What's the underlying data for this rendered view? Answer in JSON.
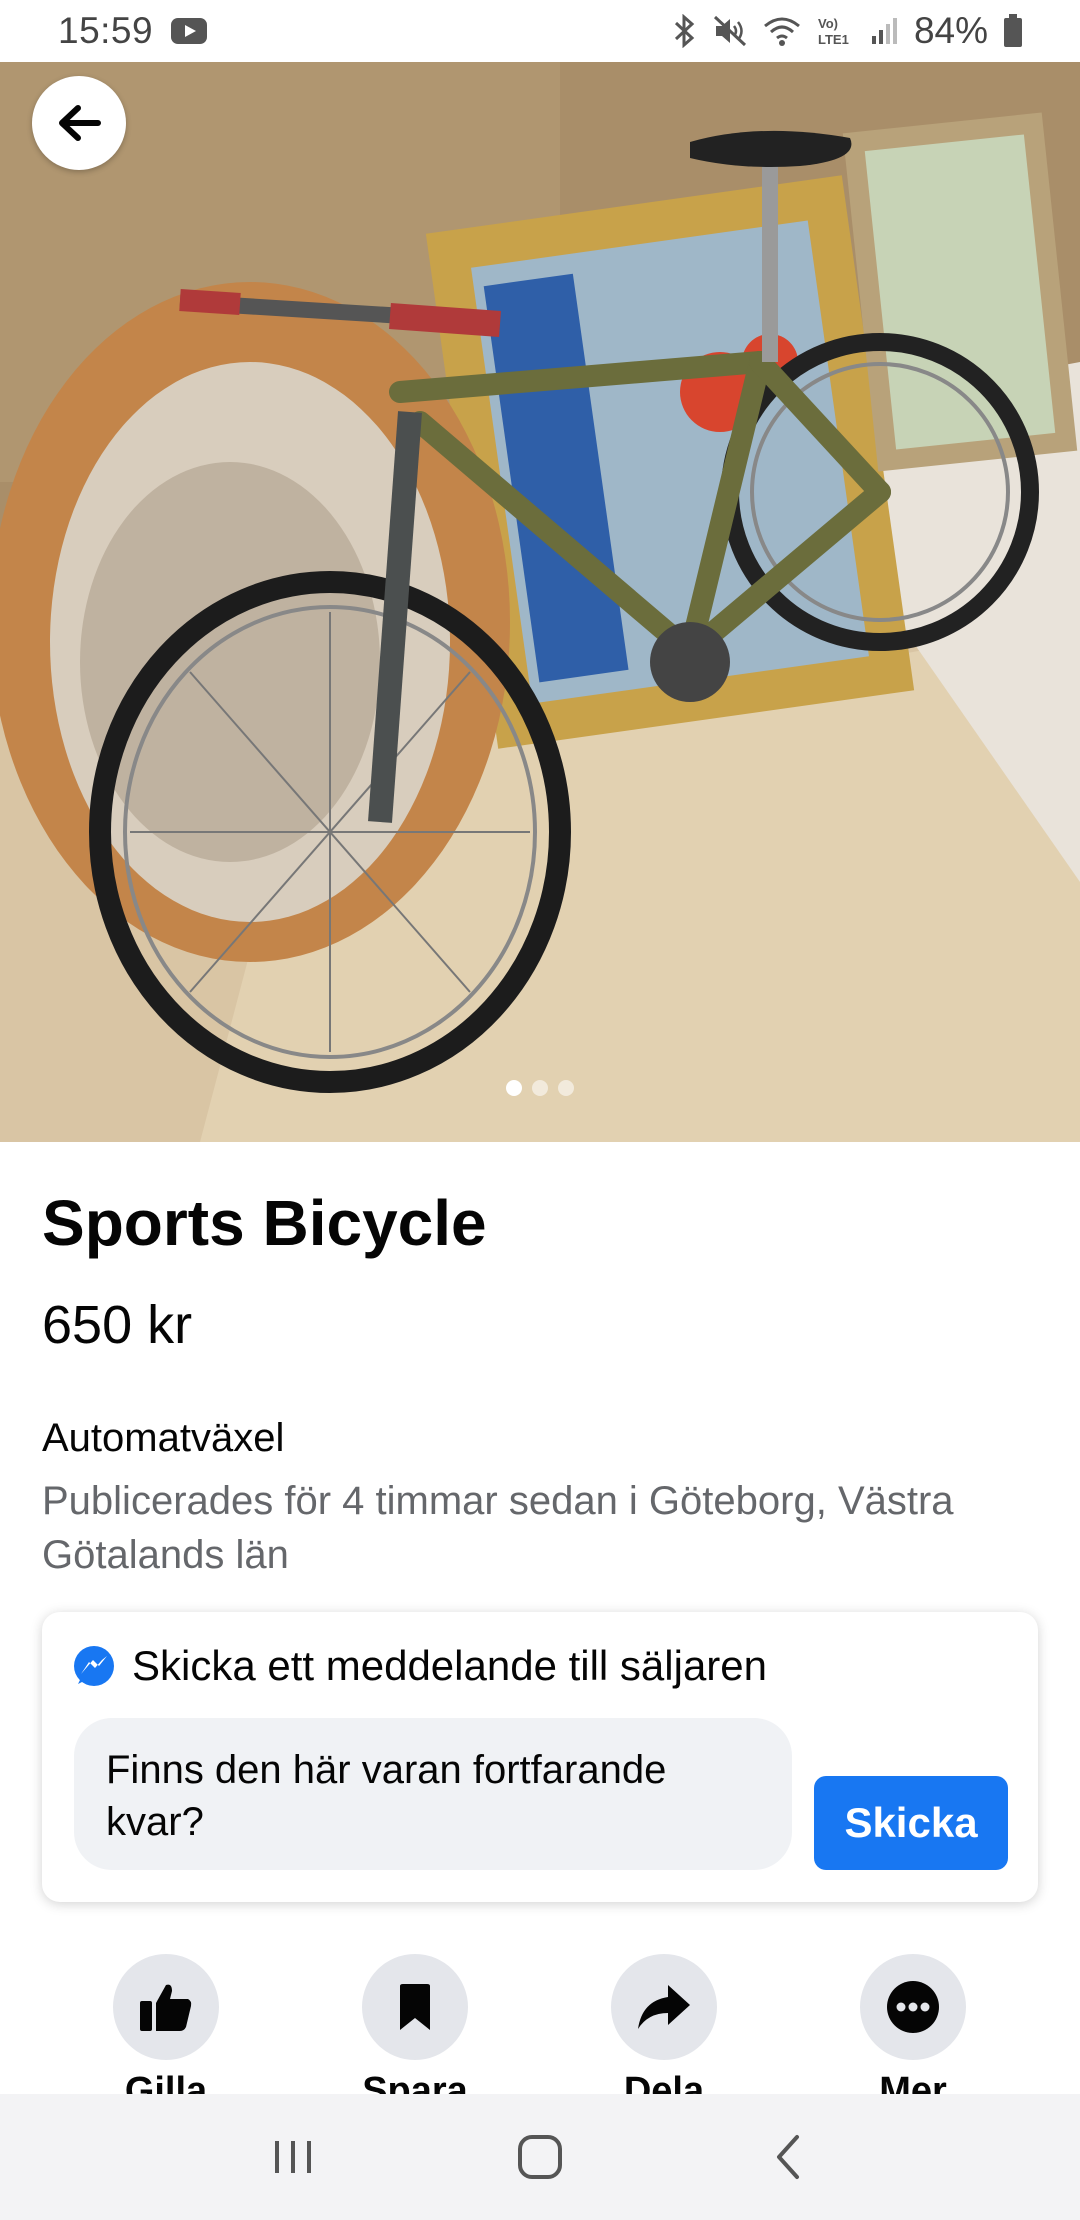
{
  "status_bar": {
    "time": "15:59",
    "battery": "84%",
    "network": "LTE1",
    "volte": "Vo)"
  },
  "listing": {
    "title": "Sports Bicycle",
    "price": "650 kr",
    "subtitle": "Automatväxel",
    "posted": "Publicerades för 4 timmar sedan i Göteborg, Västra Götalands län",
    "image_count": 3,
    "active_image": 1
  },
  "message_card": {
    "title": "Skicka ett meddelande till säljaren",
    "message": "Finns den här varan fortfarande kvar?",
    "send_label": "Skicka"
  },
  "actions": {
    "like": "Gilla",
    "save": "Spara",
    "share": "Dela",
    "more": "Mer"
  },
  "colors": {
    "accent": "#1877f2",
    "secondary_text": "#65676b",
    "button_bg": "#e4e6eb"
  }
}
